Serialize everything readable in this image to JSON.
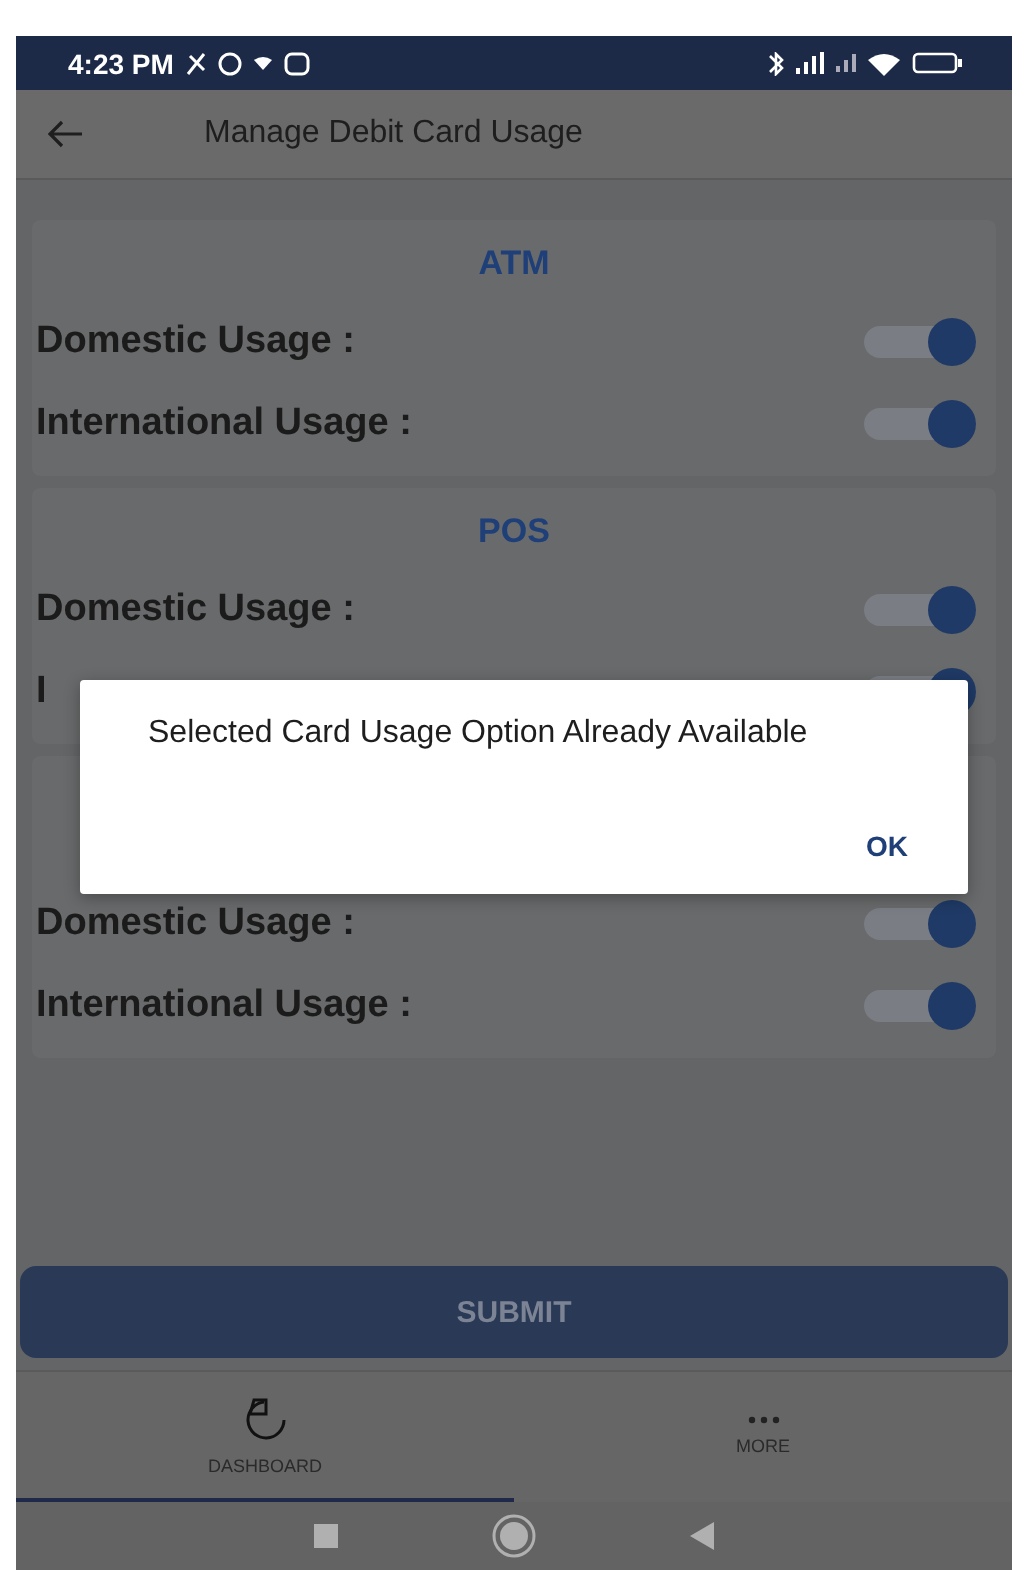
{
  "status_bar": {
    "time": "4:23 PM"
  },
  "app_bar": {
    "title": "Manage Debit Card Usage"
  },
  "sections": [
    {
      "title": "ATM",
      "rows": [
        {
          "label": "Domestic Usage :",
          "on": true
        },
        {
          "label": "International Usage :",
          "on": true
        }
      ]
    },
    {
      "title": "POS",
      "rows": [
        {
          "label": "Domestic Usage :",
          "on": true
        },
        {
          "label": "I",
          "on": true
        }
      ]
    },
    {
      "rows": [
        {
          "label": "Domestic Usage :",
          "on": true
        },
        {
          "label": "International Usage :",
          "on": true
        }
      ]
    }
  ],
  "dialog": {
    "message": "Selected Card Usage Option Already Available",
    "button": "OK"
  },
  "submit": "SUBMIT",
  "bottom_nav": [
    {
      "label": "DASHBOARD",
      "kind": "dashboard",
      "selected": true
    },
    {
      "label": "MORE",
      "kind": "more",
      "selected": false
    }
  ]
}
